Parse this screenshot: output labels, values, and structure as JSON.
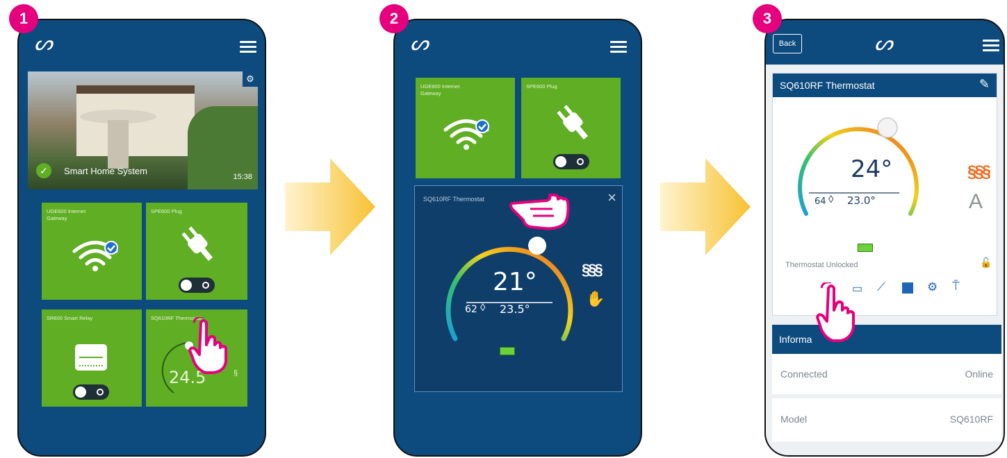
{
  "steps": [
    "1",
    "2",
    "3"
  ],
  "screen1": {
    "banner_title": "Smart Home System",
    "banner_time": "15:38",
    "tiles": [
      {
        "label": "UGE600 Internet Gateway"
      },
      {
        "label": "SPE600 Plug"
      },
      {
        "label": "SR600 Smart Relay"
      },
      {
        "label": "SQ610RF Thermostat",
        "temp": "24.5"
      }
    ]
  },
  "screen2": {
    "tiles": [
      {
        "label": "UGE600 Internet Gateway"
      },
      {
        "label": "SPE600 Plug"
      }
    ],
    "panel_title": "SQ610RF Thermostat",
    "setpoint": "21°",
    "humidity": "62",
    "current_temp": "23.5°"
  },
  "screen3": {
    "back_label": "Back",
    "card_title": "SQ610RF Thermostat",
    "setpoint": "24°",
    "humidity": "64",
    "current_temp": "23.0°",
    "mode_letter": "A",
    "lock_status": "Thermostat Unlocked",
    "info_title": "Informa",
    "rows": [
      {
        "label": "Connected",
        "value": "Online"
      },
      {
        "label": "Model",
        "value": "SQ610RF"
      }
    ]
  },
  "colors": {
    "badge": "#e6007e",
    "navy": "#0d4a7d",
    "tile_green": "#5fae23",
    "arrow": "#f7c233",
    "accent_orange": "#f06a1e"
  }
}
